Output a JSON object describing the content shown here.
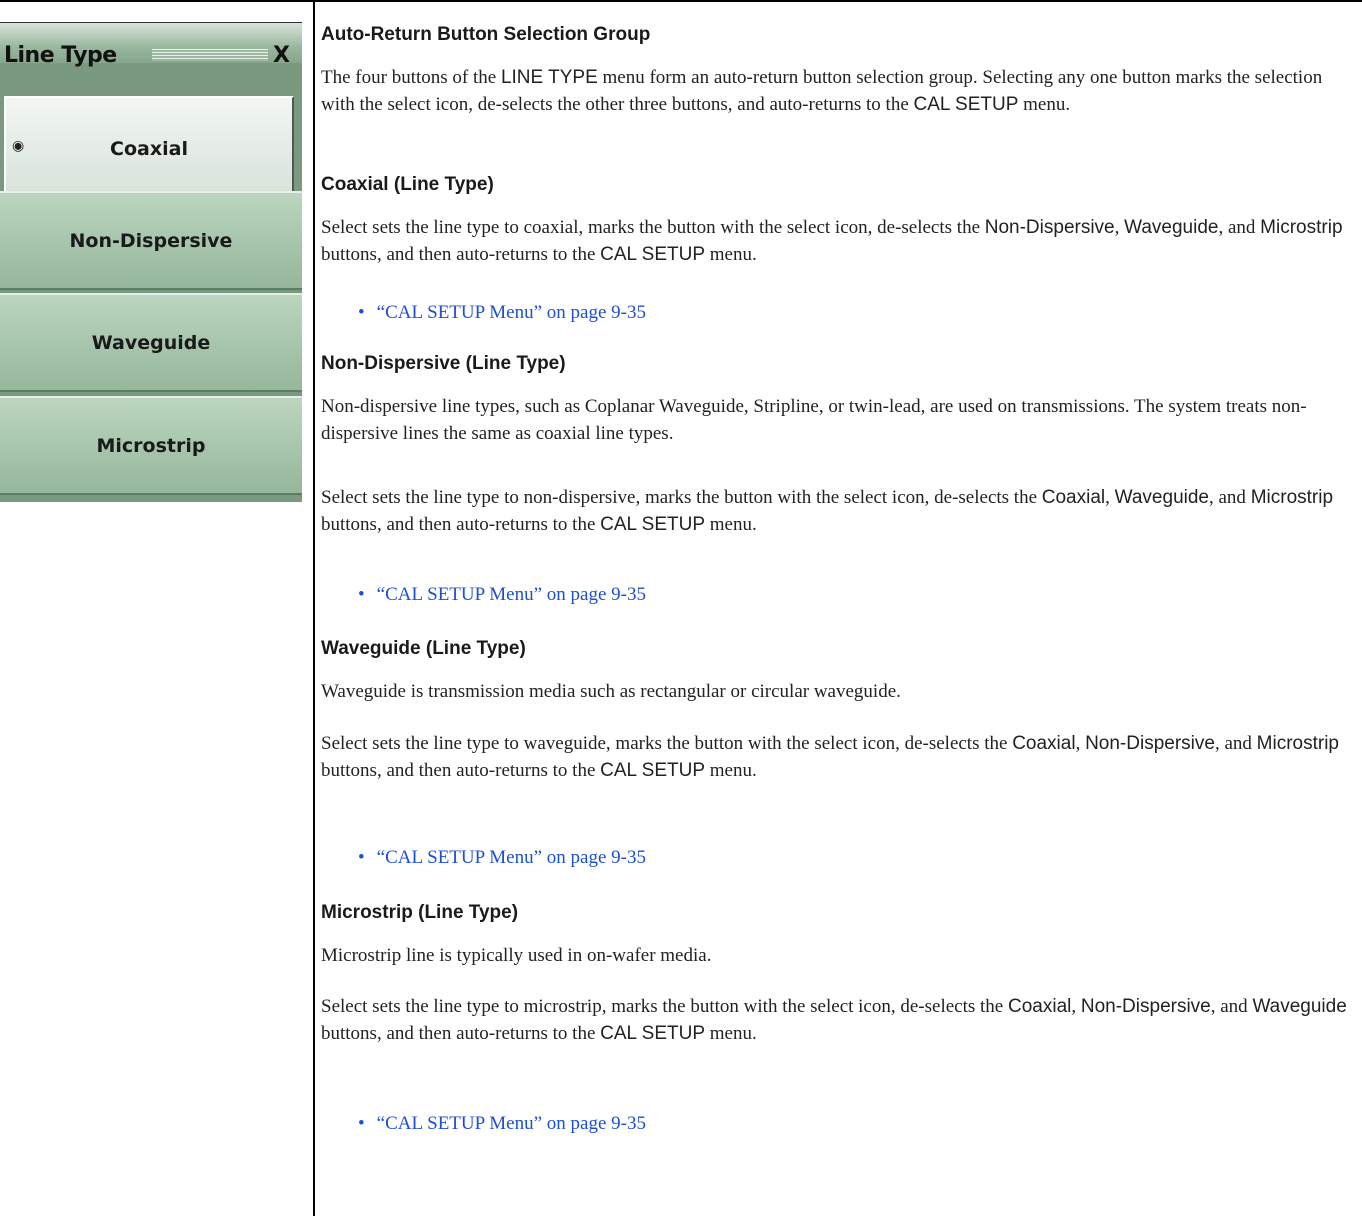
{
  "menu": {
    "title": "Line Type",
    "close": "X",
    "buttons": [
      {
        "label": "Coaxial",
        "selected": true
      },
      {
        "label": "Non-Dispersive",
        "selected": false
      },
      {
        "label": "Waveguide",
        "selected": false
      },
      {
        "label": "Microstrip",
        "selected": false
      }
    ]
  },
  "doc": {
    "h_auto": "Auto-Return Button Selection Group",
    "p_auto": [
      "The four buttons of the ",
      "LINE TYPE",
      " menu form an auto-return button selection group. Selecting any one button marks the selection with the select icon, de-selects the other three buttons, and auto-returns to the ",
      "CAL SETUP",
      " menu."
    ],
    "h_coax": "Coaxial (Line Type)",
    "p_coax": [
      "Select sets the line type to coaxial, marks the button with the select icon, de-selects the ",
      "Non-Dispersive",
      ", ",
      "Waveguide",
      ", and ",
      "Microstrip",
      " buttons, and then auto-returns to the ",
      "CAL SETUP",
      " menu."
    ],
    "link": "“CAL SETUP Menu” on page 9-35",
    "h_nondisp": "Non-Dispersive (Line Type)",
    "p_nondisp1": "Non-dispersive line types, such as Coplanar Waveguide, Stripline, or twin-lead, are used on transmissions. The system treats non-dispersive lines the same as coaxial line types.",
    "p_nondisp2": [
      "Select sets the line type to non-dispersive, marks the button with the select icon, de-selects the ",
      "Coaxial",
      ", ",
      "Waveguide",
      ", and ",
      "Microstrip",
      " buttons, and then auto-returns to the ",
      "CAL SETUP",
      " menu."
    ],
    "h_wg": "Waveguide (Line Type)",
    "p_wg1": "Waveguide is transmission media such as rectangular or circular waveguide.",
    "p_wg2": [
      "Select sets the line type to waveguide, marks the button with the select icon, de-selects the ",
      "Coaxial",
      ", ",
      "Non-Dispersive",
      ", and ",
      "Microstrip",
      " buttons, and then auto-returns to the ",
      "CAL SETUP",
      " menu."
    ],
    "h_ms": "Microstrip (Line Type)",
    "p_ms1": "Microstrip line is typically used in on-wafer media.",
    "p_ms2": [
      "Select sets the line type to microstrip, marks the button with the select icon, de-selects the ",
      "Coaxial",
      ", ",
      "Non-Dispersive",
      ", and ",
      "Waveguide",
      " buttons, and then auto-returns to the ",
      "CAL SETUP",
      " menu."
    ]
  }
}
